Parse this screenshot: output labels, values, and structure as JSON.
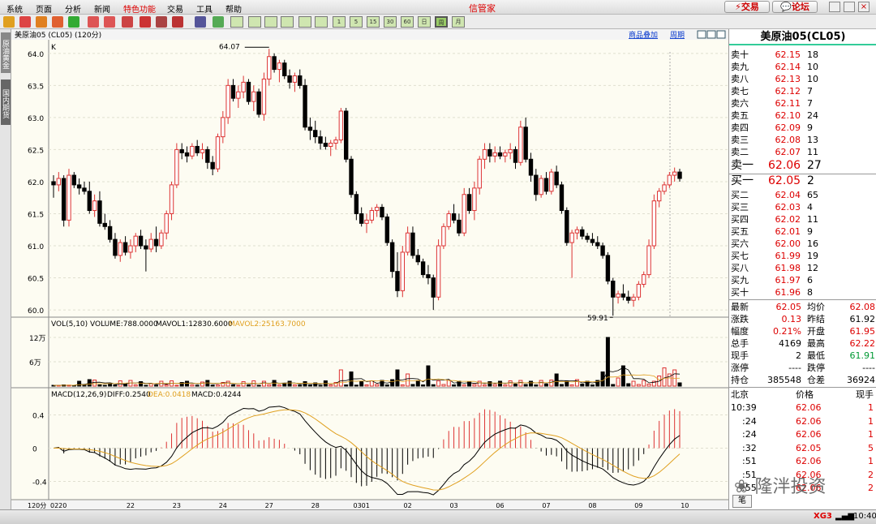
{
  "menu": {
    "items": [
      "系统",
      "页面",
      "分析",
      "新闻",
      "特色功能",
      "交易",
      "工具",
      "帮助"
    ],
    "title": "信管家",
    "trade_btn": "交易",
    "forum_btn": "论坛"
  },
  "toolbar": {
    "period_buttons": [
      "1",
      "5",
      "15",
      "30",
      "60",
      "日",
      "周",
      "月"
    ]
  },
  "left_tabs": [
    "原油黄金",
    "国内期货"
  ],
  "chart": {
    "header": "美原油05 (CL05) (120分)",
    "link_overlay": "商品叠加",
    "link_period": "周期",
    "k_label": "K",
    "high_marker": "64.07",
    "low_marker": "59.91",
    "vol_label": "VOL(5,10) VOLUME:788.0000",
    "mavol1_label": "MAVOL1:12830.6000",
    "mavol2_label": "MAVOL2:25163.7000",
    "macd_label": "MACD(12,26,9)",
    "diff_label": "DIFF:0.2540",
    "dea_label": "DEA:0.0418",
    "macdv_label": "MACD:0.4244",
    "period_label": "120分",
    "price_ticks": [
      "64.0",
      "63.5",
      "63.0",
      "62.5",
      "62.0",
      "61.5",
      "61.0",
      "60.5",
      "60.0"
    ],
    "vol_ticks": [
      "12万",
      "6万"
    ],
    "macd_ticks": [
      "0.4",
      "0",
      "-0.4"
    ],
    "x_ticks": [
      "0220",
      "22",
      "23",
      "24",
      "27",
      "28",
      "0301",
      "02",
      "03",
      "06",
      "07",
      "08",
      "09",
      "10"
    ],
    "colors": {
      "up": "#d33",
      "down": "#000",
      "diff": "#000",
      "dea": "#e0a020"
    }
  },
  "chart_data": {
    "type": "candlestick",
    "title": "美原油05 (CL05) (120分)",
    "price_ylim": [
      59.9,
      64.2
    ],
    "ohlc": [
      [
        62.0,
        62.1,
        61.75,
        61.95
      ],
      [
        61.95,
        62.15,
        61.85,
        62.05
      ],
      [
        62.05,
        62.1,
        61.3,
        61.4
      ],
      [
        61.4,
        62.2,
        61.3,
        62.1
      ],
      [
        62.1,
        62.15,
        61.9,
        61.95
      ],
      [
        61.95,
        62.05,
        61.8,
        61.9
      ],
      [
        61.9,
        62.0,
        61.8,
        61.85
      ],
      [
        61.85,
        62.0,
        61.5,
        61.55
      ],
      [
        61.55,
        61.8,
        61.45,
        61.7
      ],
      [
        61.7,
        61.85,
        61.3,
        61.35
      ],
      [
        61.35,
        61.5,
        61.25,
        61.3
      ],
      [
        61.3,
        61.4,
        61.05,
        61.1
      ],
      [
        61.1,
        61.2,
        60.8,
        60.85
      ],
      [
        60.85,
        61.1,
        60.75,
        61.05
      ],
      [
        61.05,
        61.15,
        60.85,
        60.9
      ],
      [
        60.9,
        61.1,
        60.8,
        61.0
      ],
      [
        61.0,
        61.2,
        60.9,
        61.15
      ],
      [
        61.15,
        61.25,
        60.95,
        61.0
      ],
      [
        61.0,
        61.1,
        60.6,
        60.95
      ],
      [
        60.95,
        61.2,
        60.9,
        61.1
      ],
      [
        61.1,
        61.3,
        60.9,
        61.0
      ],
      [
        61.0,
        61.25,
        60.95,
        61.2
      ],
      [
        61.2,
        61.55,
        61.1,
        61.5
      ],
      [
        61.5,
        62.0,
        61.4,
        61.95
      ],
      [
        61.95,
        62.6,
        61.9,
        62.5
      ],
      [
        62.5,
        62.6,
        62.35,
        62.45
      ],
      [
        62.45,
        62.55,
        62.3,
        62.4
      ],
      [
        62.4,
        62.6,
        62.35,
        62.55
      ],
      [
        62.55,
        62.65,
        62.4,
        62.45
      ],
      [
        62.45,
        62.6,
        62.35,
        62.5
      ],
      [
        62.5,
        62.55,
        62.2,
        62.3
      ],
      [
        62.3,
        62.4,
        62.1,
        62.2
      ],
      [
        62.2,
        62.75,
        62.15,
        62.7
      ],
      [
        62.7,
        63.1,
        62.6,
        63.0
      ],
      [
        63.0,
        63.6,
        62.9,
        63.5
      ],
      [
        63.5,
        63.6,
        63.25,
        63.3
      ],
      [
        63.3,
        63.5,
        63.15,
        63.4
      ],
      [
        63.4,
        63.65,
        63.3,
        63.55
      ],
      [
        63.55,
        63.6,
        63.2,
        63.25
      ],
      [
        63.25,
        63.5,
        63.1,
        63.4
      ],
      [
        63.4,
        63.45,
        63.0,
        63.05
      ],
      [
        63.05,
        63.7,
        62.95,
        63.6
      ],
      [
        63.6,
        64.07,
        63.5,
        63.95
      ],
      [
        63.95,
        64.0,
        63.7,
        63.75
      ],
      [
        63.75,
        63.9,
        63.55,
        63.85
      ],
      [
        63.85,
        63.9,
        63.6,
        63.65
      ],
      [
        63.65,
        63.75,
        63.45,
        63.55
      ],
      [
        63.55,
        63.7,
        63.4,
        63.65
      ],
      [
        63.65,
        63.75,
        63.45,
        63.5
      ],
      [
        63.5,
        63.6,
        62.8,
        62.85
      ],
      [
        62.85,
        63.0,
        62.65,
        62.8
      ],
      [
        62.8,
        62.95,
        62.6,
        62.7
      ],
      [
        62.7,
        62.8,
        62.5,
        62.6
      ],
      [
        62.6,
        62.7,
        62.5,
        62.55
      ],
      [
        62.55,
        62.65,
        62.4,
        62.6
      ],
      [
        62.6,
        62.7,
        62.5,
        62.65
      ],
      [
        62.65,
        63.15,
        62.6,
        63.1
      ],
      [
        63.1,
        63.15,
        62.3,
        62.35
      ],
      [
        62.35,
        62.4,
        61.75,
        61.8
      ],
      [
        61.8,
        61.85,
        61.4,
        61.5
      ],
      [
        61.5,
        61.6,
        61.3,
        61.35
      ],
      [
        61.35,
        61.5,
        61.2,
        61.4
      ],
      [
        61.4,
        61.6,
        61.35,
        61.55
      ],
      [
        61.55,
        61.65,
        61.45,
        61.6
      ],
      [
        61.6,
        61.65,
        61.4,
        61.45
      ],
      [
        61.45,
        61.5,
        61.0,
        61.05
      ],
      [
        61.05,
        61.1,
        60.5,
        60.6
      ],
      [
        60.6,
        60.9,
        60.2,
        60.3
      ],
      [
        60.3,
        61.0,
        60.2,
        60.9
      ],
      [
        60.9,
        61.3,
        60.85,
        61.2
      ],
      [
        61.2,
        61.3,
        60.8,
        60.85
      ],
      [
        60.85,
        60.95,
        60.7,
        60.75
      ],
      [
        60.75,
        60.8,
        60.5,
        60.55
      ],
      [
        60.55,
        60.7,
        60.4,
        60.5
      ],
      [
        60.5,
        60.55,
        60.0,
        60.2
      ],
      [
        60.2,
        61.1,
        60.15,
        61.0
      ],
      [
        61.0,
        61.35,
        60.95,
        61.3
      ],
      [
        61.3,
        61.55,
        61.25,
        61.5
      ],
      [
        61.5,
        61.65,
        61.35,
        61.4
      ],
      [
        61.4,
        61.5,
        61.15,
        61.2
      ],
      [
        61.2,
        61.9,
        61.15,
        61.8
      ],
      [
        61.8,
        61.9,
        61.5,
        61.55
      ],
      [
        61.55,
        62.0,
        61.4,
        61.9
      ],
      [
        61.9,
        62.4,
        61.8,
        62.35
      ],
      [
        62.35,
        62.6,
        62.2,
        62.5
      ],
      [
        62.5,
        62.6,
        62.3,
        62.4
      ],
      [
        62.4,
        62.55,
        62.3,
        62.45
      ],
      [
        62.45,
        62.55,
        62.35,
        62.4
      ],
      [
        62.4,
        62.5,
        62.3,
        62.45
      ],
      [
        62.45,
        62.6,
        62.35,
        62.5
      ],
      [
        62.5,
        62.55,
        62.2,
        62.3
      ],
      [
        62.3,
        62.95,
        62.25,
        62.85
      ],
      [
        62.85,
        63.0,
        62.3,
        62.35
      ],
      [
        62.35,
        62.45,
        62.0,
        62.1
      ],
      [
        62.1,
        62.2,
        61.7,
        61.8
      ],
      [
        61.8,
        62.1,
        61.75,
        62.05
      ],
      [
        62.05,
        62.15,
        61.8,
        61.85
      ],
      [
        61.85,
        62.2,
        61.8,
        62.15
      ],
      [
        62.15,
        62.25,
        61.9,
        61.95
      ],
      [
        61.95,
        62.0,
        61.5,
        61.55
      ],
      [
        61.55,
        61.6,
        61.0,
        61.05
      ],
      [
        61.05,
        61.25,
        60.5,
        61.2
      ],
      [
        61.2,
        61.3,
        61.1,
        61.25
      ],
      [
        61.25,
        61.3,
        61.1,
        61.15
      ],
      [
        61.15,
        61.2,
        61.05,
        61.1
      ],
      [
        61.1,
        61.2,
        61.0,
        61.05
      ],
      [
        61.05,
        61.15,
        60.95,
        61.0
      ],
      [
        61.0,
        61.05,
        60.8,
        60.85
      ],
      [
        60.85,
        60.9,
        60.4,
        60.45
      ],
      [
        60.45,
        60.5,
        59.91,
        60.2
      ],
      [
        60.2,
        60.3,
        60.1,
        60.25
      ],
      [
        60.25,
        60.4,
        60.15,
        60.2
      ],
      [
        60.2,
        60.3,
        60.1,
        60.15
      ],
      [
        60.15,
        60.25,
        60.05,
        60.2
      ],
      [
        60.2,
        60.45,
        60.15,
        60.4
      ],
      [
        60.4,
        60.6,
        60.35,
        60.55
      ],
      [
        60.55,
        61.1,
        60.5,
        61.0
      ],
      [
        61.0,
        61.8,
        60.95,
        61.7
      ],
      [
        61.7,
        61.9,
        61.6,
        61.85
      ],
      [
        61.85,
        62.0,
        61.8,
        61.95
      ],
      [
        61.95,
        62.15,
        61.9,
        62.1
      ],
      [
        62.1,
        62.22,
        62.0,
        62.15
      ],
      [
        62.15,
        62.2,
        62.0,
        62.05
      ]
    ],
    "volume_ylim": [
      0,
      140000
    ],
    "volume": [
      2000,
      1500,
      3000,
      2500,
      1800,
      12000,
      2000,
      16000,
      15000,
      3000,
      2000,
      5000,
      3000,
      13000,
      4000,
      14000,
      3000,
      11000,
      2000,
      6000,
      2500,
      12000,
      3000,
      13000,
      2000,
      9000,
      12000,
      3000,
      2000,
      10000,
      14000,
      2500,
      3000,
      9000,
      12000,
      3000,
      2000,
      11000,
      3000,
      13000,
      2000,
      12000,
      3500,
      14000,
      3000,
      6000,
      12000,
      3000,
      2500,
      11000,
      3000,
      8000,
      2000,
      13000,
      3000,
      9000,
      40000,
      3000,
      35000,
      2500,
      12000,
      3000,
      13000,
      4000,
      14000,
      3000,
      16000,
      40000,
      3000,
      30000,
      4000,
      12000,
      3000,
      50000,
      3500,
      13000,
      4000,
      14000,
      3000,
      12000,
      3000,
      11000,
      4000,
      12000,
      3000,
      11000,
      4000,
      12000,
      3000,
      13000,
      5000,
      14000,
      4000,
      12000,
      3000,
      14000,
      5000,
      15000,
      30000,
      4000,
      12000,
      3000,
      16000,
      5000,
      12000,
      3000,
      14000,
      35000,
      120000,
      4000,
      20000,
      50000,
      6000,
      12000,
      4000,
      14000,
      5000,
      12000,
      25000,
      45000,
      30000,
      40000,
      8000,
      788
    ],
    "macd_ylim": [
      -0.6,
      0.6
    ],
    "macd_series": [
      "DIFF",
      "DEA",
      "MACD"
    ]
  },
  "quote": {
    "title": "美原油05(CL05)",
    "asks": [
      [
        "卖十",
        "62.15",
        "18"
      ],
      [
        "卖九",
        "62.14",
        "10"
      ],
      [
        "卖八",
        "62.13",
        "10"
      ],
      [
        "卖七",
        "62.12",
        "7"
      ],
      [
        "卖六",
        "62.11",
        "7"
      ],
      [
        "卖五",
        "62.10",
        "24"
      ],
      [
        "卖四",
        "62.09",
        "9"
      ],
      [
        "卖三",
        "62.08",
        "13"
      ],
      [
        "卖二",
        "62.07",
        "11"
      ],
      [
        "卖一",
        "62.06",
        "27"
      ]
    ],
    "bids": [
      [
        "买一",
        "62.05",
        "2"
      ],
      [
        "买二",
        "62.04",
        "65"
      ],
      [
        "买三",
        "62.03",
        "4"
      ],
      [
        "买四",
        "62.02",
        "11"
      ],
      [
        "买五",
        "62.01",
        "9"
      ],
      [
        "买六",
        "62.00",
        "16"
      ],
      [
        "买七",
        "61.99",
        "19"
      ],
      [
        "买八",
        "61.98",
        "12"
      ],
      [
        "买九",
        "61.97",
        "6"
      ],
      [
        "买十",
        "61.96",
        "8"
      ]
    ],
    "stats": [
      [
        "最新",
        "62.05",
        "均价",
        "62.08"
      ],
      [
        "涨跌",
        "0.13",
        "昨结",
        "61.92"
      ],
      [
        "幅度",
        "0.21%",
        "开盘",
        "61.95"
      ],
      [
        "总手",
        "4169",
        "最高",
        "62.22"
      ],
      [
        "现手",
        "2",
        "最低",
        "61.91"
      ],
      [
        "涨停",
        "----",
        "跌停",
        "----"
      ],
      [
        "持仓",
        "385548",
        "仓差",
        "36924"
      ]
    ],
    "ticks_header": [
      "北京",
      "价格",
      "现手"
    ],
    "ticks": [
      [
        "10:39",
        "62.06",
        "1"
      ],
      [
        ":24",
        "62.06",
        "1"
      ],
      [
        ":24",
        "62.06",
        "1"
      ],
      [
        ":32",
        "62.05",
        "5"
      ],
      [
        ":51",
        "62.06",
        "1"
      ],
      [
        ":51",
        "62.06",
        "2"
      ],
      [
        ":55",
        "62.06",
        "2"
      ]
    ],
    "tick_tab": "笔"
  },
  "status": {
    "network": "XG3",
    "time": "10:40"
  },
  "watermark": "隆泮投资"
}
